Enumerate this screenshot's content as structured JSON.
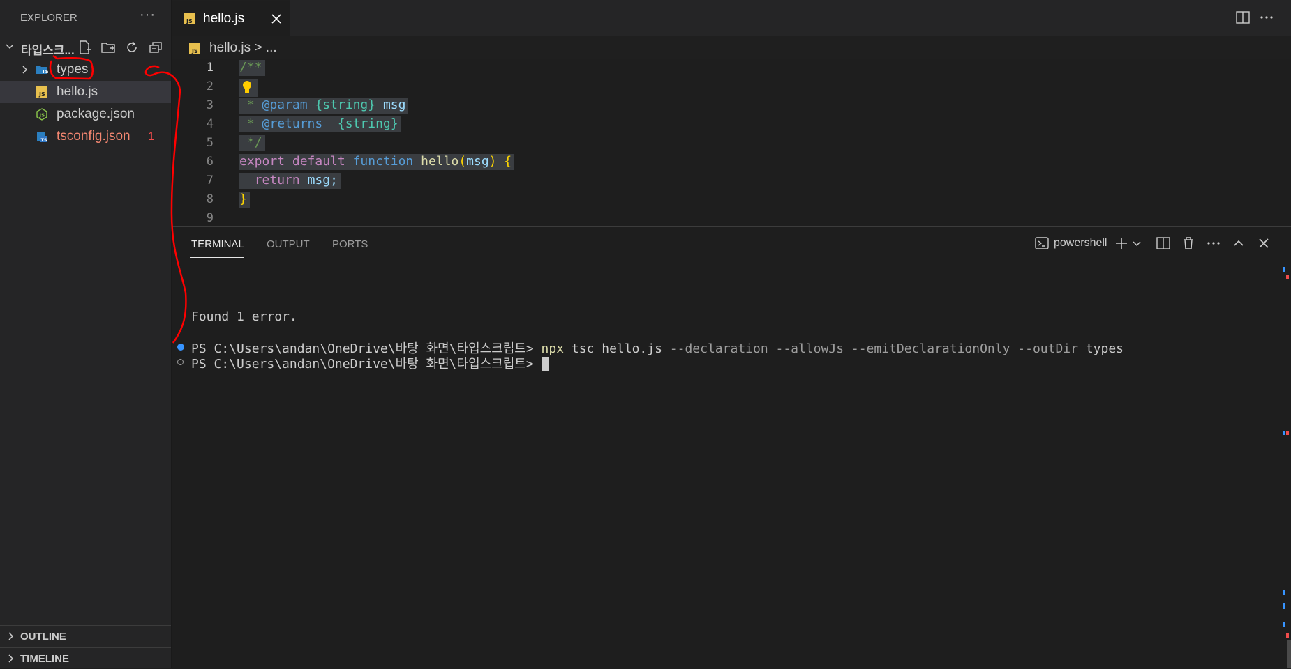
{
  "sidebar": {
    "header": "EXPLORER",
    "more": "···",
    "root_folder": "타입스크...",
    "items": [
      {
        "label": "types",
        "icon": "ts-folder-icon"
      },
      {
        "label": "hello.js",
        "icon": "js-file-icon"
      },
      {
        "label": "package.json",
        "icon": "nodejs-file-icon"
      },
      {
        "label": "tsconfig.json",
        "icon": "ts-config-file-icon",
        "badge": "1"
      }
    ],
    "outline": "OUTLINE",
    "timeline": "TIMELINE"
  },
  "tab": {
    "name": "hello.js"
  },
  "breadcrumb": {
    "file": "hello.js",
    "rest": "> ..."
  },
  "editor": {
    "line_numbers": [
      "1",
      "2",
      "3",
      "4",
      "5",
      "6",
      "7",
      "8",
      "9"
    ],
    "lines": {
      "l1": "/**",
      "l3_a": " * ",
      "l3_b": "@param",
      "l3_c": " ",
      "l3_d": "{string}",
      "l3_e": " ",
      "l3_f": "msg",
      "l4_a": " * ",
      "l4_b": "@returns",
      "l4_c": "  ",
      "l4_d": "{string}",
      "l5": " */",
      "l6_a": "export",
      "l6_b": " ",
      "l6_c": "default",
      "l6_d": " ",
      "l6_e": "function",
      "l6_f": " ",
      "l6_g": "hello",
      "l6_h": "(",
      "l6_i": "msg",
      "l6_j": ")",
      "l6_k": " ",
      "l6_l": "{",
      "l7_a": "  ",
      "l7_b": "return",
      "l7_c": " ",
      "l7_d": "msg;",
      "l8": "}"
    }
  },
  "panel": {
    "tabs": [
      "TERMINAL",
      "OUTPUT",
      "PORTS"
    ],
    "shell": "powershell",
    "terminal": {
      "found": "Found 1 error.",
      "prompt1": "PS C:\\Users\\andan\\OneDrive\\바탕 화면\\타입스크립트> ",
      "cmd": "npx",
      "cmd_rest1": " tsc hello.js ",
      "flags": "--declaration --allowJs --emitDeclarationOnly --outDir",
      "cmd_rest2": " types",
      "prompt2": "PS C:\\Users\\andan\\OneDrive\\바탕 화면\\타입스크립트> "
    }
  },
  "colors": {
    "accent": "#007acc",
    "error": "#f14c4c",
    "annotation": "#ff0000"
  }
}
